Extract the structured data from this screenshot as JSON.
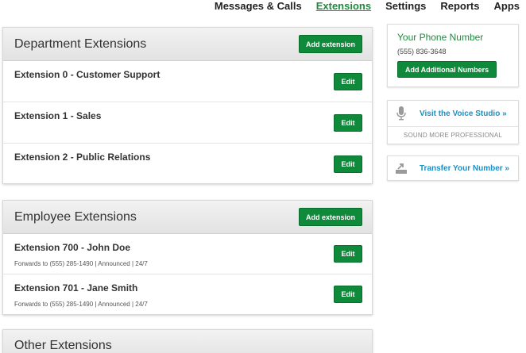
{
  "nav": {
    "items": [
      "Messages & Calls",
      "Extensions",
      "Settings",
      "Reports",
      "Apps"
    ],
    "active": "Extensions"
  },
  "department": {
    "title": "Department Extensions",
    "add_label": "Add extension",
    "rows": [
      {
        "title": "Extension 0 - Customer Support",
        "edit_label": "Edit"
      },
      {
        "title": "Extension 1 - Sales",
        "edit_label": "Edit"
      },
      {
        "title": "Extension 2 - Public Relations",
        "edit_label": "Edit"
      }
    ]
  },
  "employee": {
    "title": "Employee Extensions",
    "add_label": "Add extension",
    "rows": [
      {
        "title": "Extension 700 - John Doe",
        "details": "Forwards to (555) 285-1490 | Announced | 24/7",
        "edit_label": "Edit"
      },
      {
        "title": "Extension 701 - Jane Smith",
        "details": "Forwards to (555) 285-1490 | Announced | 24/7",
        "edit_label": "Edit"
      }
    ]
  },
  "other": {
    "title": "Other Extensions"
  },
  "sidebar": {
    "phone_title": "Your Phone Number",
    "phone_number": "(555) 836-3648",
    "add_numbers_label": "Add Additional Numbers",
    "voice_link": "Visit the Voice Studio »",
    "voice_sub": "SOUND MORE PROFESSIONAL",
    "transfer_link": "Transfer Your Number »",
    "icons": [
      "microphone-icon",
      "transfer-icon"
    ]
  },
  "colors": {
    "accent_green": "#0f8a3a",
    "link_blue": "#1a8fc4",
    "nav_active": "#1e8a3d"
  }
}
